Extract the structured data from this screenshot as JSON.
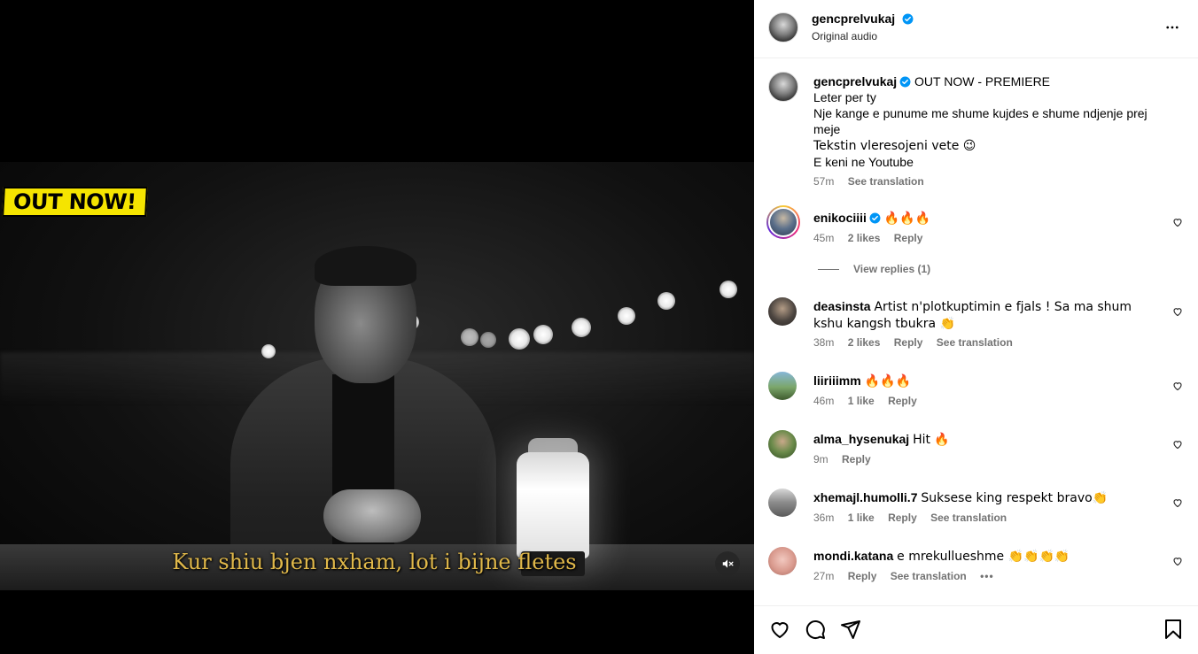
{
  "video": {
    "badge": "OUT NOW!",
    "subtitle": "Kur shiu bjen nxham, lot i bijne fletes",
    "mute_icon": "speaker-muted-icon"
  },
  "post_header": {
    "username": "gencprelvukaj",
    "audio": "Original audio",
    "more_icon": "more-horizontal-icon"
  },
  "caption": {
    "username": "gencprelvukaj",
    "lines": [
      "OUT NOW - PREMIERE",
      "Leter per ty",
      "Nje kange e punume me shume kujdes e shume ndjenje prej meje",
      "Tekstin vleresojeni vete 😉",
      "E keni ne Youtube"
    ],
    "time": "57m",
    "see_translation": "See translation"
  },
  "comments": [
    {
      "username": "enikociiii",
      "verified": true,
      "text": "🔥🔥🔥",
      "time": "45m",
      "likes": "2 likes",
      "reply": "Reply",
      "translation": "",
      "view_replies": "View replies (1)"
    },
    {
      "username": "deasinsta",
      "verified": false,
      "text": "Artist n'plotkuptimin e fjals ! Sa ma shum kshu kangsh tbukra 👏",
      "time": "38m",
      "likes": "2 likes",
      "reply": "Reply",
      "translation": "See translation"
    },
    {
      "username": "liiriiimm",
      "verified": false,
      "text": "🔥🔥🔥",
      "time": "46m",
      "likes": "1 like",
      "reply": "Reply",
      "translation": ""
    },
    {
      "username": "alma_hysenukaj",
      "verified": false,
      "text": "Hit 🔥",
      "time": "9m",
      "likes": "",
      "reply": "Reply",
      "translation": ""
    },
    {
      "username": "xhemajl.humolli.7",
      "verified": false,
      "text": "Suksese king respekt bravo👏",
      "time": "36m",
      "likes": "1 like",
      "reply": "Reply",
      "translation": "See translation"
    },
    {
      "username": "mondi.katana",
      "verified": false,
      "text": "e mrekullueshme 👏👏👏👏",
      "time": "27m",
      "likes": "",
      "reply": "Reply",
      "translation": "See translation",
      "more": "•••"
    }
  ],
  "actions": {
    "like_icon": "heart-icon",
    "comment_icon": "comment-icon",
    "share_icon": "share-icon",
    "save_icon": "bookmark-icon"
  },
  "colors": {
    "verified": "#0095f6",
    "meta_gray": "#737373",
    "badge_yellow": "#f5e400",
    "subtitle_gold": "#e0b84a"
  }
}
